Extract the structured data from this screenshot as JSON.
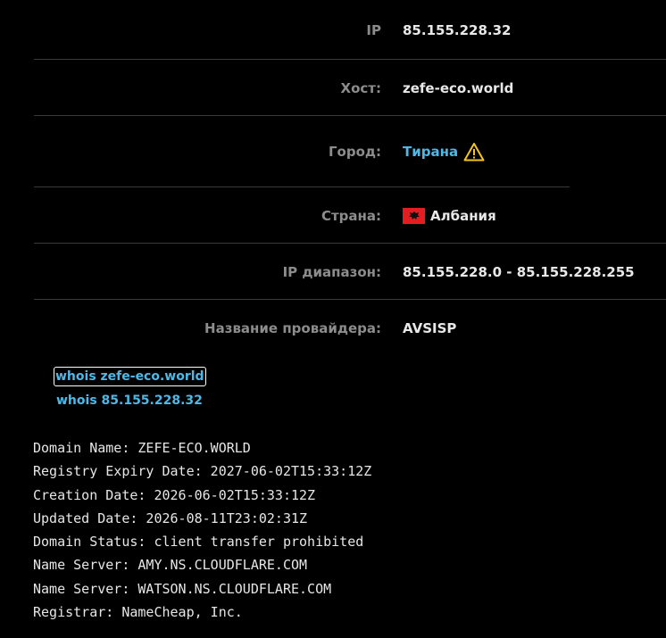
{
  "info": {
    "ip": {
      "label": "IP",
      "value": "85.155.228.32"
    },
    "host": {
      "label": "Хост:",
      "value": "zefe-eco.world"
    },
    "city": {
      "label": "Город:",
      "value": "Тирана",
      "warning_icon": "warning-triangle-icon",
      "warning_color": "#f5c518"
    },
    "country": {
      "label": "Страна:",
      "value": "Албания",
      "flag_icon": "albania-flag-icon",
      "flag_color": "#e41e20"
    },
    "ip_range": {
      "label": "IP диапазон:",
      "value": "85.155.228.0 - 85.155.228.255"
    },
    "provider": {
      "label": "Название провайдера:",
      "value": "AVSISP"
    }
  },
  "whois_links": {
    "domain": "whois zefe-eco.world",
    "ip": "whois 85.155.228.32"
  },
  "whois_output": {
    "lines": [
      "Domain Name: ZEFE-ECO.WORLD",
      "Registry Expiry Date: 2027-06-02T15:33:12Z",
      "Creation Date: 2026-06-02T15:33:12Z",
      "Updated Date: 2026-08-11T23:02:31Z",
      "Domain Status: client transfer prohibited",
      "Name Server: AMY.NS.CLOUDFLARE.COM",
      "Name Server: WATSON.NS.CLOUDFLARE.COM",
      "Registrar: NameCheap, Inc."
    ]
  },
  "colors": {
    "background": "#000000",
    "label": "#8c8c8c",
    "value": "#e8e8e8",
    "link": "#4fb8e6",
    "separator": "#3a3a3a"
  }
}
